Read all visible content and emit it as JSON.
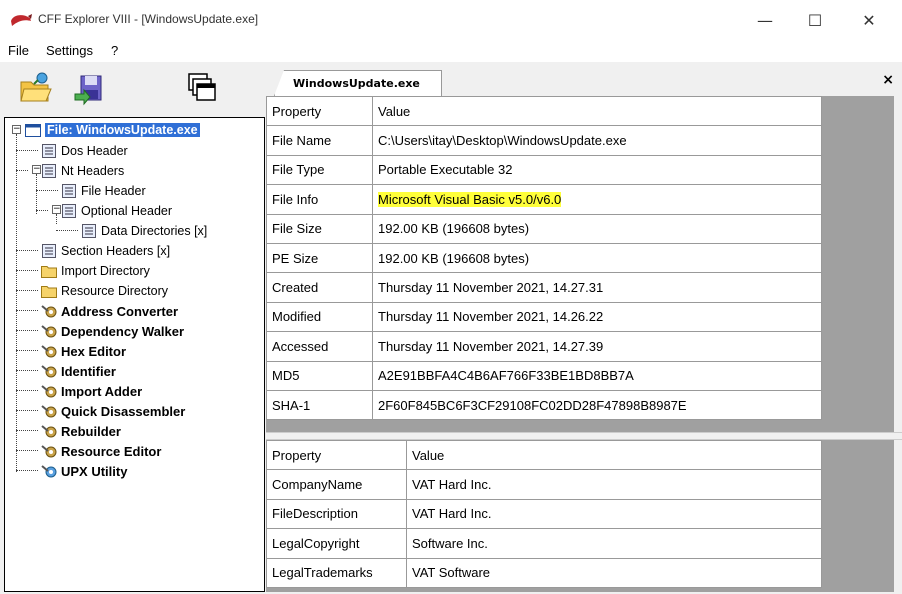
{
  "window": {
    "title": "CFF Explorer VIII - [WindowsUpdate.exe]",
    "controls": {
      "minimize": "—",
      "maximize": "☐",
      "close": "✕"
    }
  },
  "menu": {
    "file": "File",
    "settings": "Settings",
    "help": "?"
  },
  "tab": {
    "label": "WindowsUpdate.exe",
    "close": "×"
  },
  "tree": {
    "root": "File: WindowsUpdate.exe",
    "dos_header": "Dos Header",
    "nt_headers": "Nt Headers",
    "file_header": "File Header",
    "optional_header": "Optional Header",
    "data_directories": "Data Directories [x]",
    "section_headers": "Section Headers [x]",
    "import_directory": "Import Directory",
    "resource_directory": "Resource Directory",
    "tools": [
      "Address Converter",
      "Dependency Walker",
      "Hex Editor",
      "Identifier",
      "Import Adder",
      "Quick Disassembler",
      "Rebuilder",
      "Resource Editor",
      "UPX Utility"
    ]
  },
  "file_props": {
    "headers": [
      "Property",
      "Value"
    ],
    "rows": [
      [
        "File Name",
        "C:\\Users\\itay\\Desktop\\WindowsUpdate.exe"
      ],
      [
        "File Type",
        "Portable Executable 32"
      ],
      [
        "File Info",
        "Microsoft Visual Basic v5.0/v6.0"
      ],
      [
        "File Size",
        "192.00 KB (196608 bytes)"
      ],
      [
        "PE Size",
        "192.00 KB (196608 bytes)"
      ],
      [
        "Created",
        "Thursday 11 November 2021, 14.27.31"
      ],
      [
        "Modified",
        "Thursday 11 November 2021, 14.26.22"
      ],
      [
        "Accessed",
        "Thursday 11 November 2021, 14.27.39"
      ],
      [
        "MD5",
        "A2E91BBFA4C4B6AF766F33BE1BD8BB7A"
      ],
      [
        "SHA-1",
        "2F60F845BC6F3CF29108FC02DD28F47898B8987E"
      ]
    ]
  },
  "version_props": {
    "headers": [
      "Property",
      "Value"
    ],
    "rows": [
      [
        "CompanyName",
        "VAT Hard Inc."
      ],
      [
        "FileDescription",
        "VAT Hard Inc."
      ],
      [
        "LegalCopyright",
        "Software Inc."
      ],
      [
        "LegalTrademarks",
        "VAT Software"
      ]
    ]
  },
  "colors": {
    "highlight": "#ffff3a",
    "selection": "#2f6fd6",
    "panel_bg": "#a0a0a0"
  }
}
